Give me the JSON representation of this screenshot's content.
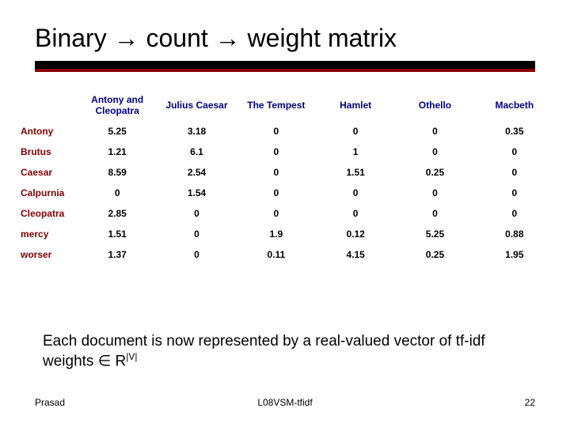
{
  "title": "Binary → count → weight matrix",
  "chart_data": {
    "type": "table",
    "columns": [
      "Antony and Cleopatra",
      "Julius Caesar",
      "The Tempest",
      "Hamlet",
      "Othello",
      "Macbeth"
    ],
    "rows": [
      {
        "label": "Antony",
        "values": [
          "5.25",
          "3.18",
          "0",
          "0",
          "0",
          "0.35"
        ]
      },
      {
        "label": "Brutus",
        "values": [
          "1.21",
          "6.1",
          "0",
          "1",
          "0",
          "0"
        ]
      },
      {
        "label": "Caesar",
        "values": [
          "8.59",
          "2.54",
          "0",
          "1.51",
          "0.25",
          "0"
        ]
      },
      {
        "label": "Calpurnia",
        "values": [
          "0",
          "1.54",
          "0",
          "0",
          "0",
          "0"
        ]
      },
      {
        "label": "Cleopatra",
        "values": [
          "2.85",
          "0",
          "0",
          "0",
          "0",
          "0"
        ]
      },
      {
        "label": "mercy",
        "values": [
          "1.51",
          "0",
          "1.9",
          "0.12",
          "5.25",
          "0.88"
        ]
      },
      {
        "label": "worser",
        "values": [
          "1.37",
          "0",
          "0.11",
          "4.15",
          "0.25",
          "1.95"
        ]
      }
    ]
  },
  "caption": {
    "pre": "Each document is now represented by a real-valued vector of tf-idf weights ∈ R",
    "sup": "|V|"
  },
  "footer": {
    "left": "Prasad",
    "center": "L08VSM-tfidf",
    "right": "22"
  }
}
